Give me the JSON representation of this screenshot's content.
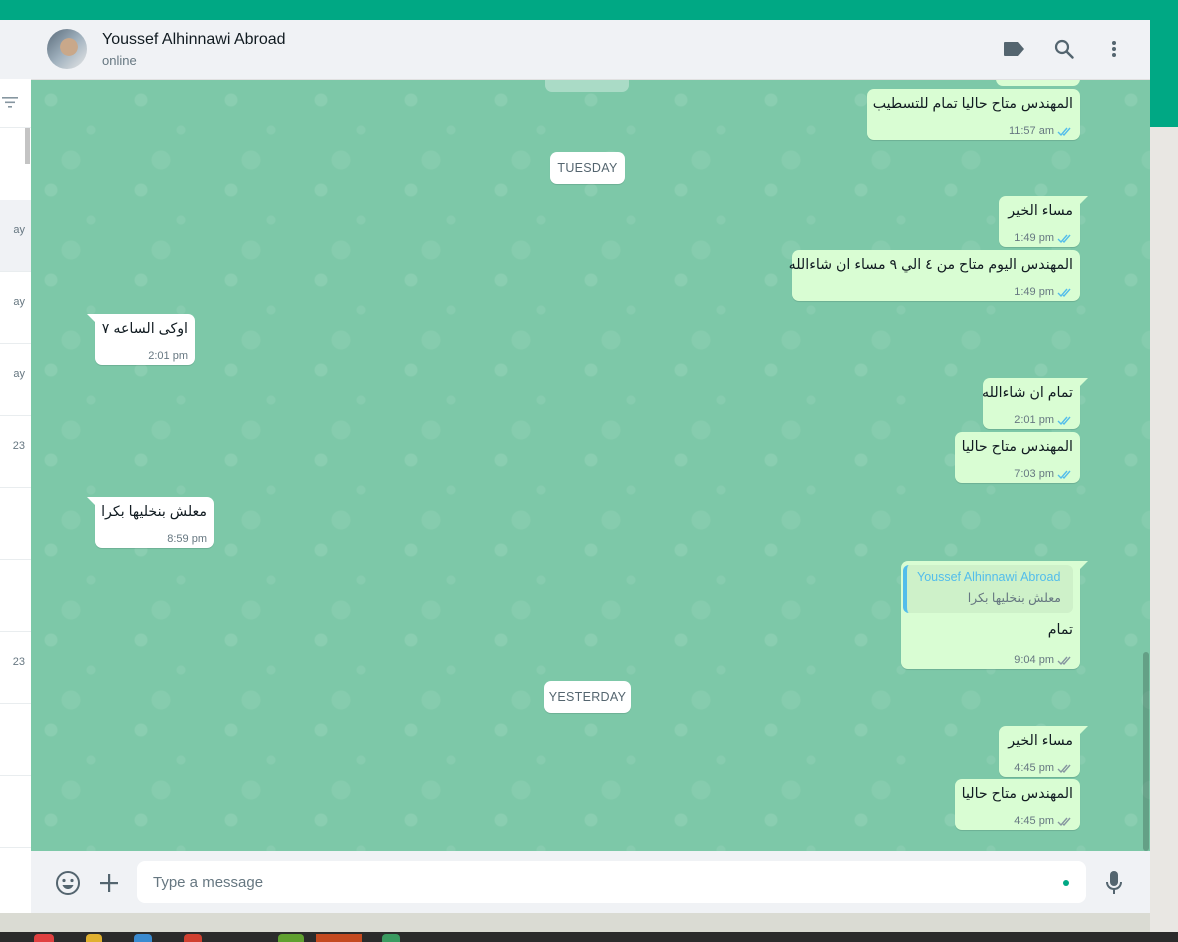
{
  "colors": {
    "accent": "#00a884",
    "outgoing_bubble": "#d9fdd3",
    "incoming_bubble": "#ffffff",
    "wallpaper": "#7dc8a8",
    "read_tick": "#53bdeb",
    "sent_tick": "#8696a0"
  },
  "sidebar": {
    "filter_icon": "filter-icon",
    "rows": [
      {
        "label": "ay"
      },
      {
        "label": "ay"
      },
      {
        "label": "ay"
      },
      {
        "label": "23"
      },
      {
        "label": ""
      },
      {
        "label": ""
      },
      {
        "label": "23"
      },
      {
        "label": ""
      },
      {
        "label": ""
      }
    ]
  },
  "header": {
    "contact_name": "Youssef Alhinnawi Abroad",
    "status": "online",
    "icons": [
      "label-icon",
      "search-icon",
      "more-vertical-icon"
    ]
  },
  "messages": [
    {
      "type": "out",
      "text": "المهندس متاح حاليا تمام للتسطيب",
      "time": "11:57 am",
      "status": "read"
    },
    {
      "type": "day",
      "label": "TUESDAY"
    },
    {
      "type": "out",
      "text": "مساء الخير",
      "time": "1:49 pm",
      "status": "read"
    },
    {
      "type": "out",
      "text": "المهندس اليوم متاح من ٤ الي ٩ مساء ان شاءالله",
      "time": "1:49 pm",
      "status": "read"
    },
    {
      "type": "in",
      "text": "اوكى الساعه ٧",
      "time": "2:01 pm"
    },
    {
      "type": "out",
      "text": "تمام ان شاءالله",
      "time": "2:01 pm",
      "status": "read"
    },
    {
      "type": "out",
      "text": "المهندس متاح حاليا",
      "time": "7:03 pm",
      "status": "read"
    },
    {
      "type": "in",
      "text": "معلش بنخليها بكرا",
      "time": "8:59 pm"
    },
    {
      "type": "out_reply",
      "quote_name": "Youssef Alhinnawi Abroad",
      "quote_text": "معلش بنخليها بكرا",
      "text": "تمام",
      "time": "9:04 pm",
      "status": "delivered"
    },
    {
      "type": "day",
      "label": "YESTERDAY"
    },
    {
      "type": "out",
      "text": "مساء الخير",
      "time": "4:45 pm",
      "status": "delivered"
    },
    {
      "type": "out",
      "text": "المهندس متاح حاليا",
      "time": "4:45 pm",
      "status": "delivered"
    }
  ],
  "composer": {
    "placeholder": "Type a message",
    "icons": [
      "emoji-icon",
      "plus-icon",
      "microphone-icon"
    ]
  }
}
